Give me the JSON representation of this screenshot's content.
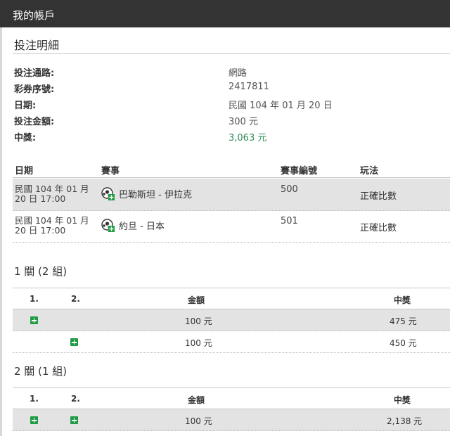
{
  "header": {
    "title": "我的帳戶"
  },
  "section": {
    "title": "投注明細"
  },
  "details": [
    {
      "label": "投注通路:",
      "value": "網路"
    },
    {
      "label": "彩券序號:",
      "value": "2417811"
    },
    {
      "label": "日期:",
      "value": "民國 104 年 01 月 20 日"
    },
    {
      "label": "投注金額:",
      "value": "300 元"
    },
    {
      "label": "中獎:",
      "value": "3,063 元"
    }
  ],
  "matches": {
    "columns": [
      "日期",
      "賽事",
      "賽事編號",
      "玩法"
    ],
    "rows": [
      {
        "date_line1": "民國 104 年 01 月",
        "date_line2": "20 日 17:00",
        "icon": "soccer-ball-add-icon",
        "event": "巴勒斯坦 - 伊拉克",
        "number": "500",
        "play": "正確比數"
      },
      {
        "date_line1": "民國 104 年 01 月",
        "date_line2": "20 日 17:00",
        "icon": "soccer-ball-add-icon",
        "event": "約旦 - 日本",
        "number": "501",
        "play": "正確比數"
      }
    ]
  },
  "groups": [
    {
      "title": "1 關 (2 組)",
      "columns": [
        "1.",
        "2.",
        "金額",
        "中獎"
      ],
      "rows": [
        {
          "col1": true,
          "col2": false,
          "amount": "100 元",
          "prize": "475 元"
        },
        {
          "col1": false,
          "col2": true,
          "amount": "100 元",
          "prize": "450 元"
        }
      ]
    },
    {
      "title": "2 關 (1 組)",
      "columns": [
        "1.",
        "2.",
        "金額",
        "中獎"
      ],
      "rows": [
        {
          "col1": true,
          "col2": true,
          "amount": "100 元",
          "prize": "2,138 元"
        }
      ]
    }
  ],
  "colors": {
    "topbar": "#333333",
    "prize_green": "#2e8b57",
    "plus_green": "#1f9b46",
    "row_shade": "#e3e3e3"
  }
}
